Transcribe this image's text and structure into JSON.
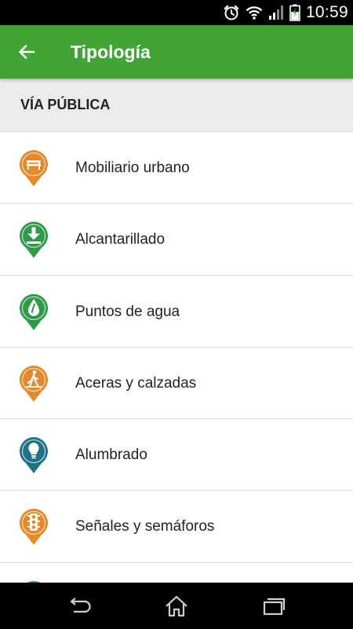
{
  "status_bar": {
    "time": "10:59",
    "icons": [
      "alarm-icon",
      "wifi-icon",
      "signal-icon",
      "battery-charging-icon"
    ]
  },
  "app_bar": {
    "title": "Tipología",
    "back_icon": "arrow-left-icon",
    "color": "#41a536"
  },
  "section": {
    "title": "VÍA PÚBLICA"
  },
  "items": [
    {
      "label": "Mobiliario urbano",
      "icon": "bench-icon",
      "color": "#e5892a"
    },
    {
      "label": "Alcantarillado",
      "icon": "drain-icon",
      "color": "#2e9b48"
    },
    {
      "label": "Puntos de agua",
      "icon": "water-drop-icon",
      "color": "#2e9b48"
    },
    {
      "label": "Aceras y calzadas",
      "icon": "pedestrian-icon",
      "color": "#e5892a"
    },
    {
      "label": "Alumbrado",
      "icon": "light-bulb-icon",
      "color": "#1e7288"
    },
    {
      "label": "Señales y semáforos",
      "icon": "traffic-light-icon",
      "color": "#e5892a"
    }
  ],
  "nav_bar": {
    "buttons": [
      "back-icon",
      "home-icon",
      "recent-apps-icon"
    ]
  }
}
